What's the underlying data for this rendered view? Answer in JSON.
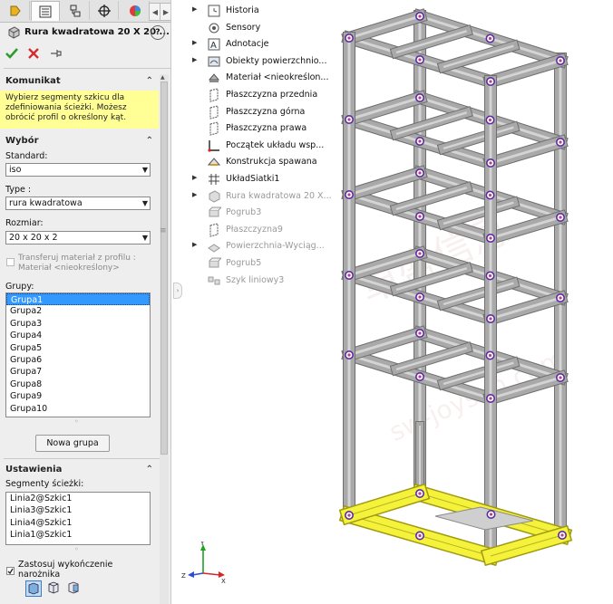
{
  "property_manager": {
    "title": "Rura kwadratowa 20 X 20 ...",
    "help": "?",
    "tabs": [
      "feature-manager",
      "property-manager",
      "configuration-manager",
      "dim-xpert",
      "display-manager"
    ],
    "message_section": {
      "header": "Komunikat",
      "text": "Wybierz segmenty szkicu dla zdefiniowania ścieżki. Możesz obrócić profil o określony kąt."
    },
    "selection_section": {
      "header": "Wybór",
      "standard_label": "Standard:",
      "standard_value": "iso",
      "type_label": "Type :",
      "type_value": "rura kwadratowa",
      "size_label": "Rozmiar:",
      "size_value": "20 x 20 x 2",
      "transfer_material_label": "Transferuj materiał z profilu :",
      "transfer_material_sub": "Materiał <nieokreślony>",
      "groups_label": "Grupy:",
      "groups": [
        "Grupa1",
        "Grupa2",
        "Grupa3",
        "Grupa4",
        "Grupa5",
        "Grupa6",
        "Grupa7",
        "Grupa8",
        "Grupa9",
        "Grupa10"
      ],
      "selected_group": "Grupa1",
      "new_group_button": "Nowa grupa"
    },
    "settings_section": {
      "header": "Ustawienia",
      "path_segments_label": "Segmenty ścieżki:",
      "path_segments": [
        "Linia2@Szkic1",
        "Linia3@Szkic1",
        "Linia4@Szkic1",
        "Linia1@Szkic1"
      ],
      "corner_treatment_label": "Zastosuj wykończenie narożnika",
      "corner_treatment_checked": true
    }
  },
  "feature_tree": [
    {
      "label": "Historia",
      "icon": "history-icon",
      "expandable": true,
      "dim": false
    },
    {
      "label": "Sensory",
      "icon": "sensor-icon",
      "expandable": false,
      "dim": false
    },
    {
      "label": "Adnotacje",
      "icon": "annotation-icon",
      "expandable": true,
      "dim": false
    },
    {
      "label": "Obiekty powierzchnio...",
      "icon": "surface-bodies-icon",
      "expandable": true,
      "dim": false
    },
    {
      "label": "Materiał <nieokreślon...",
      "icon": "material-icon",
      "expandable": false,
      "dim": false
    },
    {
      "label": "Płaszczyzna przednia",
      "icon": "plane-icon",
      "expandable": false,
      "dim": false
    },
    {
      "label": "Płaszczyzna górna",
      "icon": "plane-icon",
      "expandable": false,
      "dim": false
    },
    {
      "label": "Płaszczyzna prawa",
      "icon": "plane-icon",
      "expandable": false,
      "dim": false
    },
    {
      "label": "Początek układu wsp...",
      "icon": "origin-icon",
      "expandable": false,
      "dim": false
    },
    {
      "label": "Konstrukcja spawana",
      "icon": "weldment-icon",
      "expandable": false,
      "dim": false
    },
    {
      "label": "UkładSiatki1",
      "icon": "grid-icon",
      "expandable": true,
      "dim": false
    },
    {
      "label": "Rura kwadratowa 20 X...",
      "icon": "structural-member-icon",
      "expandable": true,
      "dim": true
    },
    {
      "label": "Pogrub3",
      "icon": "thicken-icon",
      "expandable": false,
      "dim": true
    },
    {
      "label": "Płaszczyzna9",
      "icon": "plane-icon",
      "expandable": false,
      "dim": true
    },
    {
      "label": "Powierzchnia-Wyciąg...",
      "icon": "extruded-surface-icon",
      "expandable": true,
      "dim": true
    },
    {
      "label": "Pogrub5",
      "icon": "thicken-icon",
      "expandable": false,
      "dim": true
    },
    {
      "label": "Szyk liniowy3",
      "icon": "linear-pattern-icon",
      "expandable": false,
      "dim": true
    }
  ],
  "watermark": {
    "cn": "卓盛信息",
    "url": "sw-joysun.com"
  },
  "triad": {
    "x": "X",
    "y": "Y",
    "z": "Z"
  },
  "colors": {
    "selection_highlight": "#f5f23c",
    "frame_gray": "#9a9a9a",
    "ok_green": "#2f9a2f",
    "cancel_red": "#d22c2c",
    "node_purple": "#5a2da0"
  }
}
